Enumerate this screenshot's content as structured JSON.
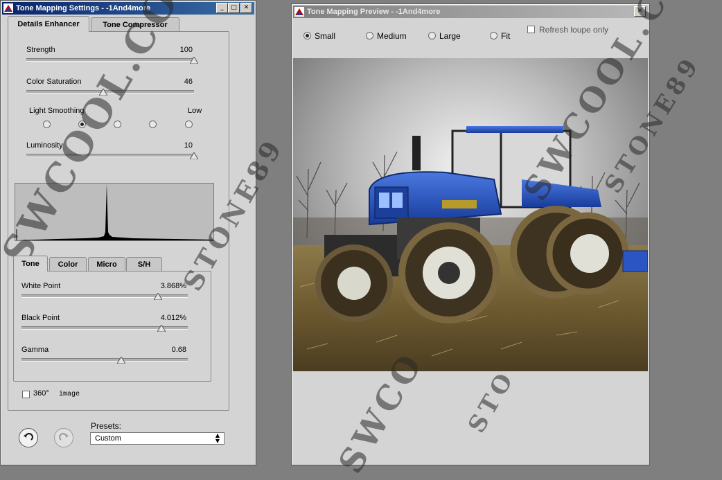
{
  "settings_window": {
    "title": "Tone Mapping Settings - -1And4more",
    "tabs": [
      "Details Enhancer",
      "Tone Compressor"
    ],
    "strength": {
      "label": "Strength",
      "value": "100",
      "fraction": 1.0
    },
    "color_saturation": {
      "label": "Color Saturation",
      "value": "46",
      "fraction": 0.46
    },
    "light_smoothing": {
      "label": "Light Smoothing",
      "right_label": "Low",
      "selected_index": 1,
      "count": 5
    },
    "luminosity": {
      "label": "Luminosity",
      "value": "10",
      "fraction": 1.0
    },
    "sub_tabs": [
      "Tone",
      "Color",
      "Micro",
      "S/H"
    ],
    "white_point": {
      "label": "White Point",
      "value": "3.868%",
      "fraction": 0.82
    },
    "black_point": {
      "label": "Black Point",
      "value": "4.012%",
      "fraction": 0.84
    },
    "gamma": {
      "label": "Gamma",
      "value": "0.68",
      "fraction": 0.6
    },
    "image_360": {
      "label": "360°",
      "suffix": "image",
      "checked": false
    },
    "presets": {
      "label": "Presets:",
      "selected": "Custom"
    }
  },
  "preview_window": {
    "title": "Tone Mapping Preview - -1And4more",
    "sizes": [
      "Small",
      "Medium",
      "Large",
      "Fit"
    ],
    "selected_size": "Small",
    "refresh_loupe": {
      "label": "Refresh loupe only",
      "checked": false
    }
  },
  "watermarks": [
    "SWCOOL.COM",
    "STONE89",
    "SWCOOL.COM",
    "STONE89",
    "SWCO",
    "STO"
  ]
}
